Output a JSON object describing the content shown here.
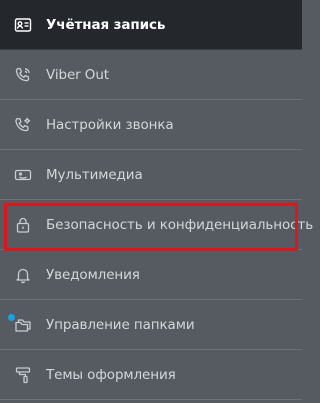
{
  "menu": {
    "items": [
      {
        "label": "Учётная запись",
        "icon": "account-card-icon",
        "active": true
      },
      {
        "label": "Viber Out",
        "icon": "phone-out-icon",
        "active": false
      },
      {
        "label": "Настройки звонка",
        "icon": "call-settings-icon",
        "active": false
      },
      {
        "label": "Мультимедиа",
        "icon": "multimedia-icon",
        "active": false
      },
      {
        "label": "Безопасность и конфиденциальность",
        "icon": "lock-icon",
        "active": false,
        "highlighted": true
      },
      {
        "label": "Уведомления",
        "icon": "bell-icon",
        "active": false
      },
      {
        "label": "Управление папками",
        "icon": "folders-icon",
        "active": false,
        "badge_dot": true
      },
      {
        "label": "Темы оформления",
        "icon": "paint-roller-icon",
        "active": false
      }
    ]
  },
  "colors": {
    "background": "#555b61",
    "active_background": "#24272c",
    "text": "#d4d7da",
    "highlight_border": "#e0141b",
    "badge_dot": "#1aa1e6"
  }
}
